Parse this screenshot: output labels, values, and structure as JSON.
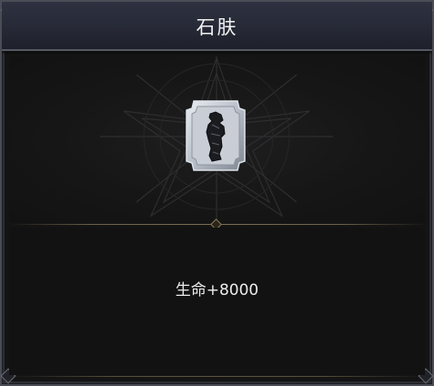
{
  "panel": {
    "title": "石肤",
    "effect": "生命+8000"
  },
  "icons": {
    "emblem": "stone-skin-fist-icon",
    "background": "star-sigil-icon"
  },
  "colors": {
    "title_bar": "#2a2e3a",
    "frame": "#4a4d55",
    "divider": "#7d7052",
    "text": "#ececec"
  }
}
